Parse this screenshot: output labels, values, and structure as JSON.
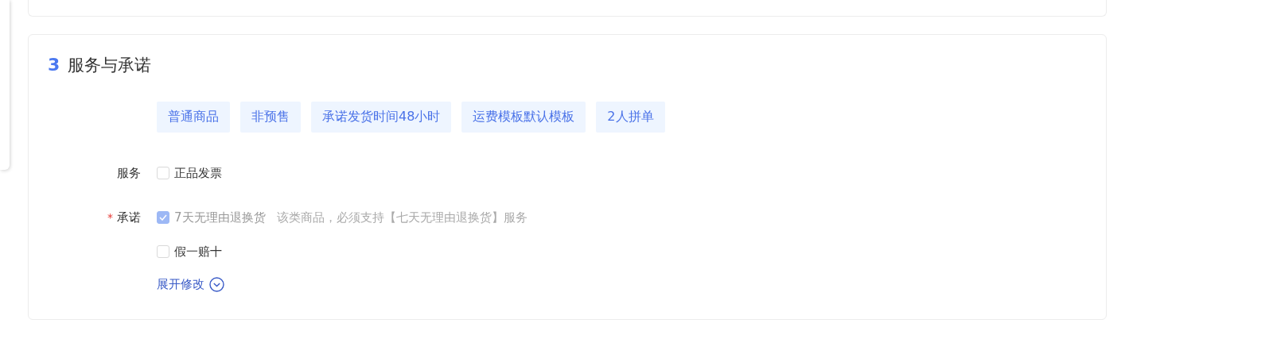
{
  "section": {
    "number": "3",
    "title": "服务与承诺"
  },
  "tags": [
    "普通商品",
    "非预售",
    "承诺发货时间48小时",
    "运费模板默认模板",
    "2人拼单"
  ],
  "fields": [
    {
      "label": "服务",
      "options": [
        {
          "label": "正品发票",
          "checked": false,
          "disabled": false
        }
      ]
    },
    {
      "label": "承诺",
      "required_mark": "*",
      "options": [
        {
          "label": "7天无理由退换货",
          "checked": true,
          "disabled": true,
          "note": "该类商品，必须支持【七天无理由退换货】服务"
        },
        {
          "label": "假一赔十",
          "checked": false,
          "disabled": false
        }
      ]
    }
  ],
  "expand_link": "展开修改"
}
